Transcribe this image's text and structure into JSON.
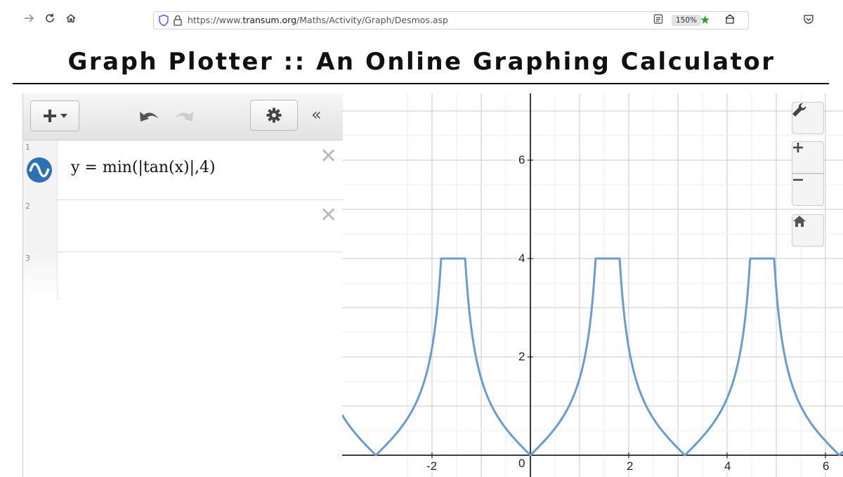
{
  "browser": {
    "url_prefix": "https://www.",
    "url_host": "transum.org",
    "url_path": "/Maths/Activity/Graph/Desmos.asp",
    "zoom": "150%",
    "icons": [
      "back-icon",
      "reload-icon",
      "home-icon",
      "shield-icon",
      "lock-icon",
      "reader-icon",
      "star-icon",
      "extension-icon",
      "pocket-icon"
    ]
  },
  "page": {
    "title": "Graph Plotter :: An Online Graphing Calculator"
  },
  "panel": {
    "expressions": [
      {
        "number": "1",
        "latex_text": "y = min(|tan(x)|,4)",
        "color": "#2d70b3"
      },
      {
        "number": "2",
        "latex_text": ""
      },
      {
        "number": "3",
        "latex_text": ""
      }
    ],
    "icons": [
      "add-icon",
      "undo-icon",
      "redo-icon",
      "gear-icon",
      "collapse-icon",
      "close-icon"
    ]
  },
  "graph": {
    "x_ticks": [
      "-2",
      "0",
      "2",
      "4",
      "6"
    ],
    "y_ticks": [
      "2",
      "4",
      "6"
    ],
    "curve_color": "#6a9bd1",
    "controls": [
      "wrench-icon",
      "zoom-in-icon",
      "zoom-out-icon",
      "home-icon"
    ]
  }
}
